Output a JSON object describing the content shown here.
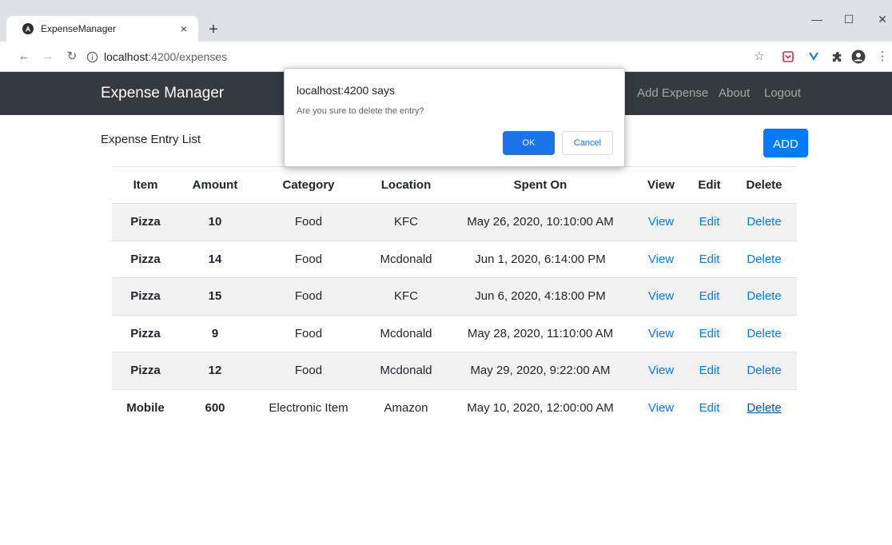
{
  "browser": {
    "tab_title": "ExpenseManager",
    "tab_close": "×",
    "new_tab": "+",
    "url_host": "localhost",
    "url_rest": ":4200/expenses",
    "window_controls": {
      "minimize": "—",
      "maximize": "☐",
      "close": "✕"
    },
    "icons": [
      "star-icon",
      "pocket-icon",
      "vue-devtools-icon",
      "extensions-icon",
      "profile-icon",
      "menu-icon"
    ]
  },
  "navbar": {
    "brand": "Expense Manager",
    "links": {
      "add": "Add Expense",
      "about": "About",
      "logout": "Logout"
    }
  },
  "page": {
    "title": "Expense Entry List",
    "add_button": "ADD"
  },
  "table": {
    "headers": [
      "Item",
      "Amount",
      "Category",
      "Location",
      "Spent On",
      "View",
      "Edit",
      "Delete"
    ],
    "rows": [
      {
        "item": "Pizza",
        "amount": "10",
        "category": "Food",
        "location": "KFC",
        "spent_on": "May 26, 2020, 10:10:00 AM",
        "view": "View",
        "edit": "Edit",
        "delete": "Delete"
      },
      {
        "item": "Pizza",
        "amount": "14",
        "category": "Food",
        "location": "Mcdonald",
        "spent_on": "Jun 1, 2020, 6:14:00 PM",
        "view": "View",
        "edit": "Edit",
        "delete": "Delete"
      },
      {
        "item": "Pizza",
        "amount": "15",
        "category": "Food",
        "location": "KFC",
        "spent_on": "Jun 6, 2020, 4:18:00 PM",
        "view": "View",
        "edit": "Edit",
        "delete": "Delete"
      },
      {
        "item": "Pizza",
        "amount": "9",
        "category": "Food",
        "location": "Mcdonald",
        "spent_on": "May 28, 2020, 11:10:00 AM",
        "view": "View",
        "edit": "Edit",
        "delete": "Delete"
      },
      {
        "item": "Pizza",
        "amount": "12",
        "category": "Food",
        "location": "Mcdonald",
        "spent_on": "May 29, 2020, 9:22:00 AM",
        "view": "View",
        "edit": "Edit",
        "delete": "Delete"
      },
      {
        "item": "Mobile",
        "amount": "600",
        "category": "Electronic Item",
        "location": "Amazon",
        "spent_on": "May 10, 2020, 12:00:00 AM",
        "view": "View",
        "edit": "Edit",
        "delete": "Delete"
      }
    ]
  },
  "dialog": {
    "title": "localhost:4200 says",
    "message": "Are you sure to delete the entry?",
    "ok": "OK",
    "cancel": "Cancel"
  },
  "colors": {
    "navbar": "#343a40",
    "primary": "#007bff",
    "dialog_button": "#1a73e8"
  }
}
